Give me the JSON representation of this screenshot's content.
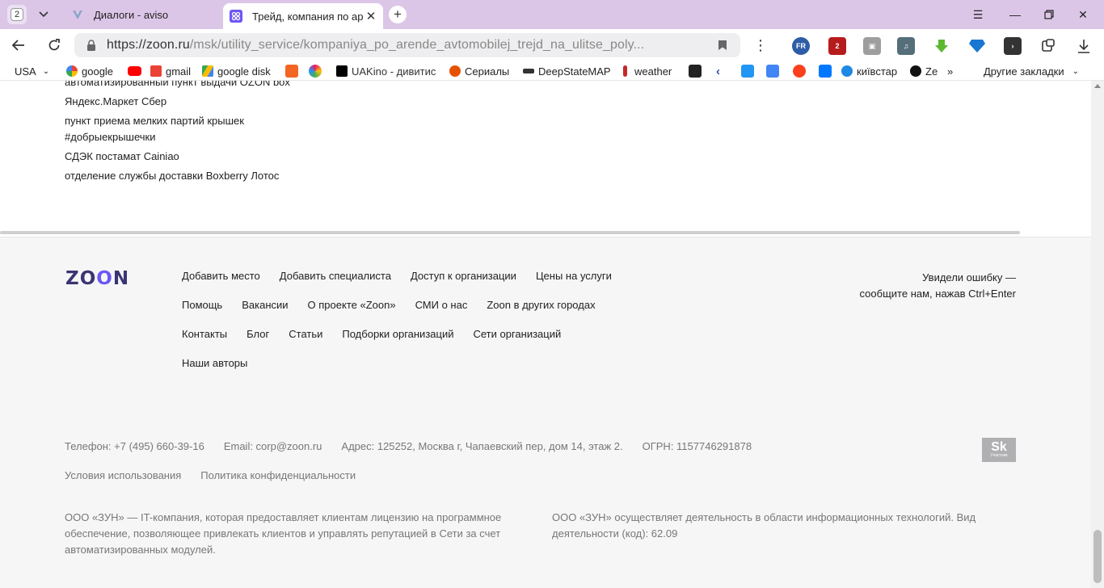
{
  "browser": {
    "tab_count": "2",
    "tabs": [
      {
        "title": "Диалоги - aviso",
        "active": false
      },
      {
        "title": "Трейд, компания по ар",
        "active": true
      }
    ],
    "url_host": "https://zoon.ru",
    "url_path": "/msk/utility_service/kompaniya_po_arende_avtomobilej_trejd_na_ulitse_poly..."
  },
  "bookmarks": [
    {
      "label": "USA",
      "icon": "chevron-down-icon"
    },
    {
      "label": "google",
      "icon": "google-icon",
      "color": "#4285f4"
    },
    {
      "label": "",
      "icon": "youtube-icon",
      "color": "#ff0000"
    },
    {
      "label": "gmail",
      "icon": "gmail-icon",
      "color": "#ea4335"
    },
    {
      "label": "google disk",
      "icon": "drive-icon",
      "color": "#fbbc04"
    },
    {
      "label": "",
      "icon": "f-icon",
      "color": "#f26522"
    },
    {
      "label": "",
      "icon": "star-icon",
      "color": "#e91e63"
    },
    {
      "label": "UAKino - дивитис",
      "icon": "uakino-icon",
      "color": "#000000"
    },
    {
      "label": "Сериалы",
      "icon": "series-icon",
      "color": "#e65100"
    },
    {
      "label": "DeepStateMAP",
      "icon": "deepstate-icon",
      "color": "#333333"
    },
    {
      "label": "weather",
      "icon": "thermometer-icon",
      "color": "#c62828"
    },
    {
      "label": "",
      "icon": "bc-icon",
      "color": "#222222"
    },
    {
      "label": "",
      "icon": "arrow-left-icon",
      "color": "#3949ab"
    },
    {
      "label": "",
      "icon": "p-icon",
      "color": "#2196f3"
    },
    {
      "label": "",
      "icon": "translate-icon",
      "color": "#4285f4"
    },
    {
      "label": "",
      "icon": "yandex-icon",
      "color": "#fc3f1d"
    },
    {
      "label": "",
      "icon": "vk-icon",
      "color": "#0077ff"
    },
    {
      "label": "київстар",
      "icon": "kyivstar-icon",
      "color": "#1e88e5"
    },
    {
      "label": "Ze",
      "icon": "z-icon",
      "color": "#111111"
    },
    {
      "label": "»",
      "icon": "more-icon"
    },
    {
      "label": "Другие закладки",
      "icon": "chevron-down-icon"
    }
  ],
  "pickup_points": [
    "автоматизированный пункт выдачи OZON box",
    "Яндекс.Маркет Сбер",
    "пункт приема мелких партий крышек",
    "#добрыекрышечки",
    "СДЭК постамат Cainiao",
    "отделение службы доставки Boxberry Лотос"
  ],
  "footer": {
    "logo": "ZOON",
    "nav_rows": [
      [
        "Добавить место",
        "Добавить специалиста",
        "Доступ к организации",
        "Цены на услуги"
      ],
      [
        "Помощь",
        "Вакансии",
        "О проекте «Zoon»",
        "СМИ о нас",
        "Zoon в других городах"
      ],
      [
        "Контакты",
        "Блог",
        "Статьи",
        "Подборки организаций",
        "Сети организаций"
      ],
      [
        "Наши авторы"
      ]
    ],
    "feedback_line1": "Увидели ошибку —",
    "feedback_line2": "сообщите нам, нажав Ctrl+Enter",
    "contacts": {
      "phone": "Телефон: +7 (495) 660-39-16",
      "email": "Email: corp@zoon.ru",
      "address": "Адрес: 125252, Москва г, Чапаевский пер, дом 14, этаж 2.",
      "ogrn": "ОГРН: 1157746291878"
    },
    "terms": "Условия использования",
    "privacy": "Политика конфиденциальности",
    "legal_left": "ООО «ЗУН» — IT-компания, которая предоставляет клиентам лицензию на программное обеспечение, позволяющее привлекать клиентов и управлять репутацией в Сети за счет автоматизированных модулей.",
    "legal_right": "ООО «ЗУН» осуществляет деятельность в области информационных технологий. Вид деятельности (код): 62.09",
    "sk_badge": "Sk",
    "sk_badge_sub": "Участник"
  }
}
